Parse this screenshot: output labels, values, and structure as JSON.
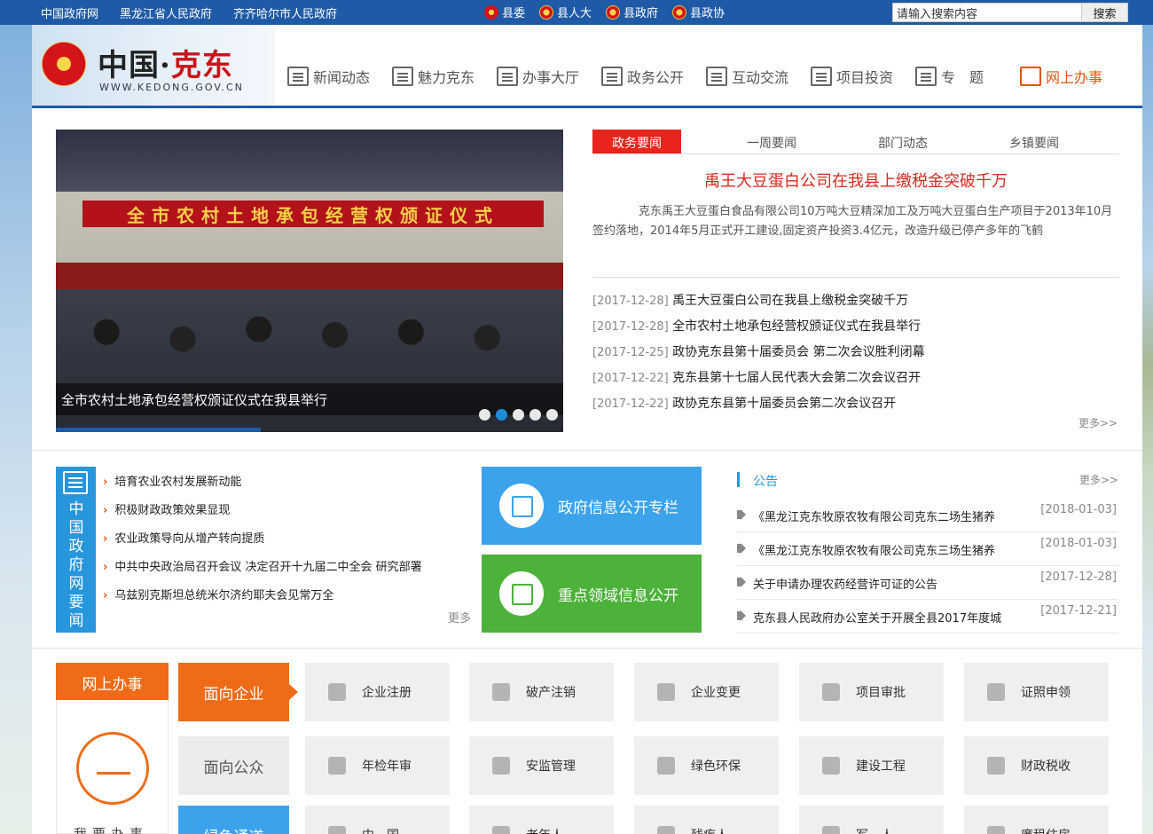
{
  "topbar": {
    "links": [
      "中国政府网",
      "黑龙江省人民政府",
      "齐齐哈尔市人民政府"
    ],
    "orgs": [
      {
        "label": "县委",
        "icon": "party-emblem-icon"
      },
      {
        "label": "县人大",
        "icon": "national-emblem-icon"
      },
      {
        "label": "县政府",
        "icon": "national-emblem-icon"
      },
      {
        "label": "县政协",
        "icon": "national-emblem-icon"
      }
    ],
    "search": {
      "value": "请输入搜索内容",
      "button": "搜索"
    }
  },
  "header": {
    "logo_title_main": "中国·",
    "logo_title_red": "克东",
    "logo_url": "WWW.KEDONG.GOV.CN",
    "nav": [
      "新闻动态",
      "魅力克东",
      "办事大厅",
      "政务公开",
      "互动交流",
      "项目投资",
      "专　题",
      "网上办事"
    ],
    "nav_active": "网上办事",
    "accent_color": "#e1550f",
    "brand_color": "#1f5aa7"
  },
  "carousel": {
    "banner_text": "全市农村土地承包经营权颁证仪式",
    "caption": "全市农村土地承包经营权颁证仪式在我县举行",
    "active_dot": 2,
    "dot_count": 5
  },
  "news": {
    "tabs": [
      "政务要闻",
      "一周要闻",
      "部门动态",
      "乡镇要闻"
    ],
    "headline": "禹王大豆蛋白公司在我县上缴税金突破千万",
    "summary": "克东禹王大豆蛋白食品有限公司10万吨大豆精深加工及万吨大豆蛋白生产项目于2013年10月签约落地，2014年5月正式开工建设,固定资产投资3.4亿元，改造升级已停产多年的飞鹤",
    "items": [
      {
        "date": "[2017-12-28]",
        "title": "禹王大豆蛋白公司在我县上缴税金突破千万"
      },
      {
        "date": "[2017-12-28]",
        "title": "全市农村土地承包经营权颁证仪式在我县举行"
      },
      {
        "date": "[2017-12-25]",
        "title": "政协克东县第十届委员会 第二次会议胜利闭幕"
      },
      {
        "date": "[2017-12-22]",
        "title": "克东县第十七届人民代表大会第二次会议召开"
      },
      {
        "date": "[2017-12-22]",
        "title": "政协克东县第十届委员会第二次会议召开"
      }
    ],
    "more": "更多>>"
  },
  "gov_news": {
    "box_label": "中国政府网要闻",
    "items": [
      "培育农业农村发展新动能",
      "积极财政政策效果显现",
      "农业政策导向从增产转向提质",
      "中共中央政治局召开会议 决定召开十九届二中全会 研究部署",
      "乌兹别克斯坦总统米尔济约耶夫会见常万全"
    ],
    "more": "更多"
  },
  "cards": {
    "gov_info": "政府信息公开专栏",
    "key_info": "重点领域信息公开"
  },
  "notices": {
    "title": "公告",
    "more": "更多>>",
    "items": [
      {
        "title": "《黑龙江克东牧原农牧有限公司克东二场生猪养",
        "date": "[2018-01-03]"
      },
      {
        "title": "《黑龙江克东牧原农牧有限公司克东三场生猪养",
        "date": "[2018-01-03]"
      },
      {
        "title": "关于申请办理农药经营许可证的公告",
        "date": "[2017-12-28]"
      },
      {
        "title": "克东县人民政府办公室关于开展全县2017年度城",
        "date": "[2017-12-21]"
      }
    ]
  },
  "online": {
    "title": "网上办事",
    "icon_caption": "我要办事",
    "categories": [
      "面向企业",
      "面向公众",
      "绿色通道"
    ],
    "services_row1": [
      "企业注册",
      "破产注销",
      "企业变更",
      "项目审批",
      "证照申领"
    ],
    "services_row2": [
      "年检年审",
      "安监管理",
      "绿色环保",
      "建设工程",
      "财政税收"
    ],
    "services_row3": [
      "中　国",
      "老年人",
      "残疾人",
      "军　人",
      "廉租住房"
    ]
  }
}
